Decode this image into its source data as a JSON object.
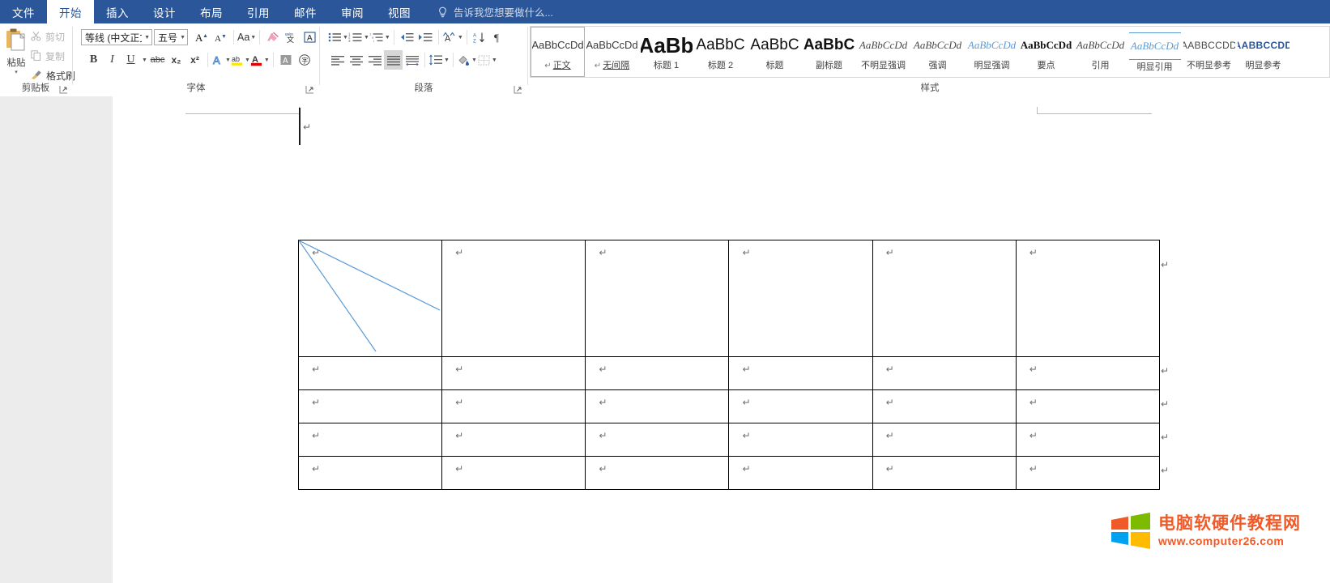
{
  "window": {
    "app": "Microsoft Word",
    "accent_color": "#2b579a",
    "tab_active_bg": "#ffffff"
  },
  "tabbar": {
    "tabs": [
      {
        "label": "文件",
        "active": false
      },
      {
        "label": "开始",
        "active": true
      },
      {
        "label": "插入",
        "active": false
      },
      {
        "label": "设计",
        "active": false
      },
      {
        "label": "布局",
        "active": false
      },
      {
        "label": "引用",
        "active": false
      },
      {
        "label": "邮件",
        "active": false
      },
      {
        "label": "审阅",
        "active": false
      },
      {
        "label": "视图",
        "active": false
      }
    ],
    "tellme": {
      "icon": "lightbulb-icon",
      "placeholder": "告诉我您想要做什么..."
    }
  },
  "ribbon": {
    "groups": [
      {
        "label": "剪贴板"
      },
      {
        "label": "字体"
      },
      {
        "label": "段落"
      },
      {
        "label": "样式"
      }
    ],
    "clipboard": {
      "paste": {
        "label": "粘贴",
        "icon": "paste-icon",
        "caret": "▾"
      },
      "cut": {
        "label": "剪切",
        "icon": "scissors-icon",
        "enabled": false
      },
      "copy": {
        "label": "复制",
        "icon": "copy-icon",
        "enabled": false
      },
      "format_painter": {
        "label": "格式刷",
        "icon": "format-painter-icon",
        "enabled": true
      },
      "dialog_launcher": "clipboard-dialog-launcher"
    },
    "font": {
      "font_name": {
        "value": "等线 (中文正文)",
        "caret": "▾"
      },
      "font_size": {
        "value": "五号",
        "caret": "▾"
      },
      "grow_font": "A▴",
      "shrink_font": "A▾",
      "change_case": "Aa",
      "clear_formatting": "clear-formatting-icon",
      "phonetic_guide": "phonetic-guide-icon",
      "character_border": "A",
      "bold": "B",
      "italic": "I",
      "underline": "U",
      "strikethrough": "abc",
      "subscript": "x₂",
      "superscript": "x²",
      "text_effects": "A",
      "highlight": "ab",
      "font_color": "A",
      "char_shading": "A",
      "enclose_char": "字",
      "dialog_launcher": "font-dialog-launcher"
    },
    "paragraph": {
      "bullets": "bullets-icon",
      "numbering": "numbering-icon",
      "multilevel": "multilevel-list-icon",
      "decrease_indent": "decrease-indent-icon",
      "increase_indent": "increase-indent-icon",
      "asian_layout": "asian-layout-icon",
      "sort": "sort-icon",
      "show_marks": "show-paragraph-marks-icon",
      "align_left": "align-left-icon",
      "align_center": "align-center-icon",
      "align_right": "align-right-icon",
      "justify": "justify-icon",
      "distribute": "distribute-icon",
      "line_spacing": "line-spacing-icon",
      "shading": "shading-icon",
      "borders": "borders-icon",
      "dialog_launcher": "paragraph-dialog-launcher",
      "selected": "justify"
    },
    "styles": {
      "items": [
        {
          "preview": "AaBbCcDd",
          "name": "正文",
          "selected": true,
          "has_pilcrow": true,
          "style": "body"
        },
        {
          "preview": "AaBbCcDd",
          "name": "无间隔",
          "selected": false,
          "has_pilcrow": true,
          "style": "body"
        },
        {
          "preview": "AaBb",
          "name": "标题 1",
          "selected": false,
          "has_pilcrow": false,
          "style": "h1"
        },
        {
          "preview": "AaBbC",
          "name": "标题 2",
          "selected": false,
          "has_pilcrow": false,
          "style": "h2"
        },
        {
          "preview": "AaBbC",
          "name": "标题",
          "selected": false,
          "has_pilcrow": false,
          "style": "h3"
        },
        {
          "preview": "AaBbC",
          "name": "副标题",
          "selected": false,
          "has_pilcrow": false,
          "style": "h3b"
        },
        {
          "preview": "AaBbCcDd",
          "name": "不明显强调",
          "selected": false,
          "has_pilcrow": false,
          "style": "it"
        },
        {
          "preview": "AaBbCcDd",
          "name": "强调",
          "selected": false,
          "has_pilcrow": false,
          "style": "it"
        },
        {
          "preview": "AaBbCcDd",
          "name": "明显强调",
          "selected": false,
          "has_pilcrow": false,
          "style": "itblue"
        },
        {
          "preview": "AaBbCcDd",
          "name": "要点",
          "selected": false,
          "has_pilcrow": false,
          "style": "bold"
        },
        {
          "preview": "AaBbCcDd",
          "name": "引用",
          "selected": false,
          "has_pilcrow": false,
          "style": "it"
        },
        {
          "preview": "AaBbCcDd",
          "name": "明显引用",
          "selected": false,
          "has_pilcrow": false,
          "style": "itblueline"
        },
        {
          "preview": "AABBCCDD",
          "name": "不明显参考",
          "selected": false,
          "has_pilcrow": false,
          "style": "smallcaps"
        },
        {
          "preview": "AABBCCDD",
          "name": "明显参考",
          "selected": false,
          "has_pilcrow": false,
          "style": "smallcapsblue"
        }
      ]
    }
  },
  "document": {
    "caret_visible": true,
    "top_paragraph_mark": "↵",
    "table": {
      "columns": 6,
      "rows": 5,
      "cell_mark": "↵",
      "row_end_mark": "↵",
      "border_color": "#000000",
      "diagonal_color": "#5b9bd5",
      "diagonal_lines": 2,
      "diagonal_origin_cell": "row1-col1",
      "cells": [
        [
          "↵",
          "↵",
          "↵",
          "↵",
          "↵",
          "↵"
        ],
        [
          "↵",
          "↵",
          "↵",
          "↵",
          "↵",
          "↵"
        ],
        [
          "↵",
          "↵",
          "↵",
          "↵",
          "↵",
          "↵"
        ],
        [
          "↵",
          "↵",
          "↵",
          "↵",
          "↵",
          "↵"
        ],
        [
          "↵",
          "↵",
          "↵",
          "↵",
          "↵",
          "↵"
        ]
      ],
      "row_marks": [
        "↵",
        "↵",
        "↵",
        "↵",
        "↵"
      ]
    }
  },
  "watermark": {
    "title": "电脑软硬件教程网",
    "url": "www.computer26.com",
    "color": "#f05a28",
    "logo": "windows-logo-icon",
    "logo_colors": [
      "#f05a28",
      "#7cbb00",
      "#00a1f1",
      "#ffbb00"
    ]
  }
}
